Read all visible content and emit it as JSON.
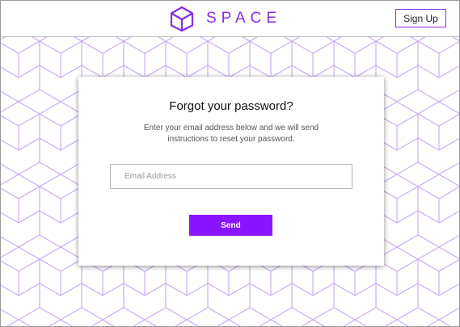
{
  "header": {
    "brand_name": "SPACE",
    "logo_icon": "cube-icon",
    "signup_label": "Sign Up"
  },
  "card": {
    "title": "Forgot your password?",
    "description": "Enter your email address below and we will send instructions to reset your password.",
    "email_value": "",
    "email_placeholder": "Email Address",
    "send_label": "Send"
  },
  "colors": {
    "accent": "#8a14ff",
    "brand": "#8a2be2",
    "pattern_line": "#c9a6f3"
  }
}
